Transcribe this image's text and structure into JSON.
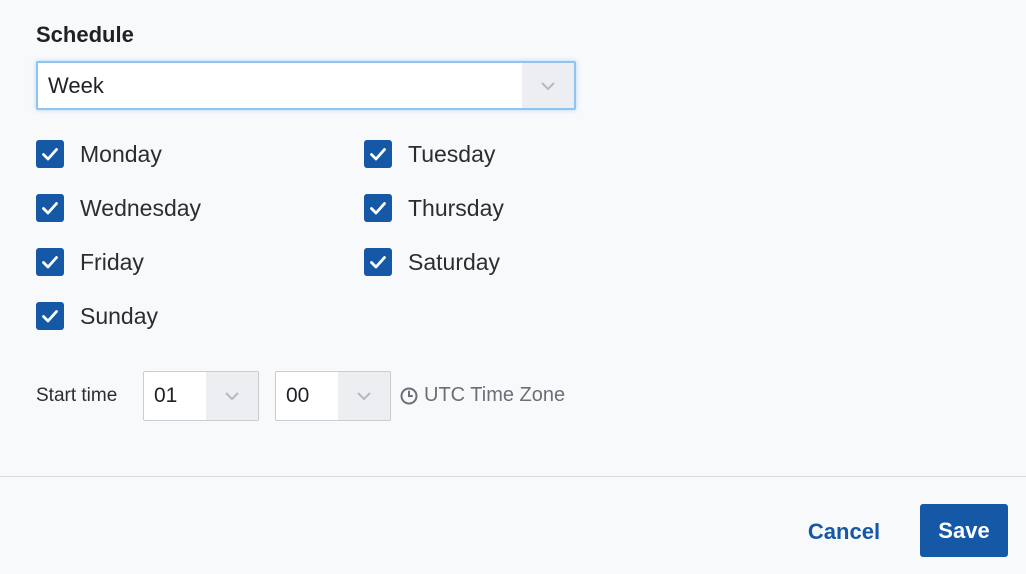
{
  "schedule": {
    "title": "Schedule",
    "selected": "Week"
  },
  "days": [
    {
      "label": "Monday",
      "checked": true
    },
    {
      "label": "Tuesday",
      "checked": true
    },
    {
      "label": "Wednesday",
      "checked": true
    },
    {
      "label": "Thursday",
      "checked": true
    },
    {
      "label": "Friday",
      "checked": true
    },
    {
      "label": "Saturday",
      "checked": true
    },
    {
      "label": "Sunday",
      "checked": true
    }
  ],
  "start_time": {
    "label": "Start time",
    "hour": "01",
    "minute": "00",
    "timezone": "UTC Time Zone"
  },
  "footer": {
    "cancel_label": "Cancel",
    "save_label": "Save"
  },
  "colors": {
    "accent": "#1558a6",
    "focus_border": "#8cc4f2"
  },
  "icons": {
    "checkbox": "checkmark-icon",
    "select": "chevron-down-icon",
    "timezone": "clock-icon"
  }
}
